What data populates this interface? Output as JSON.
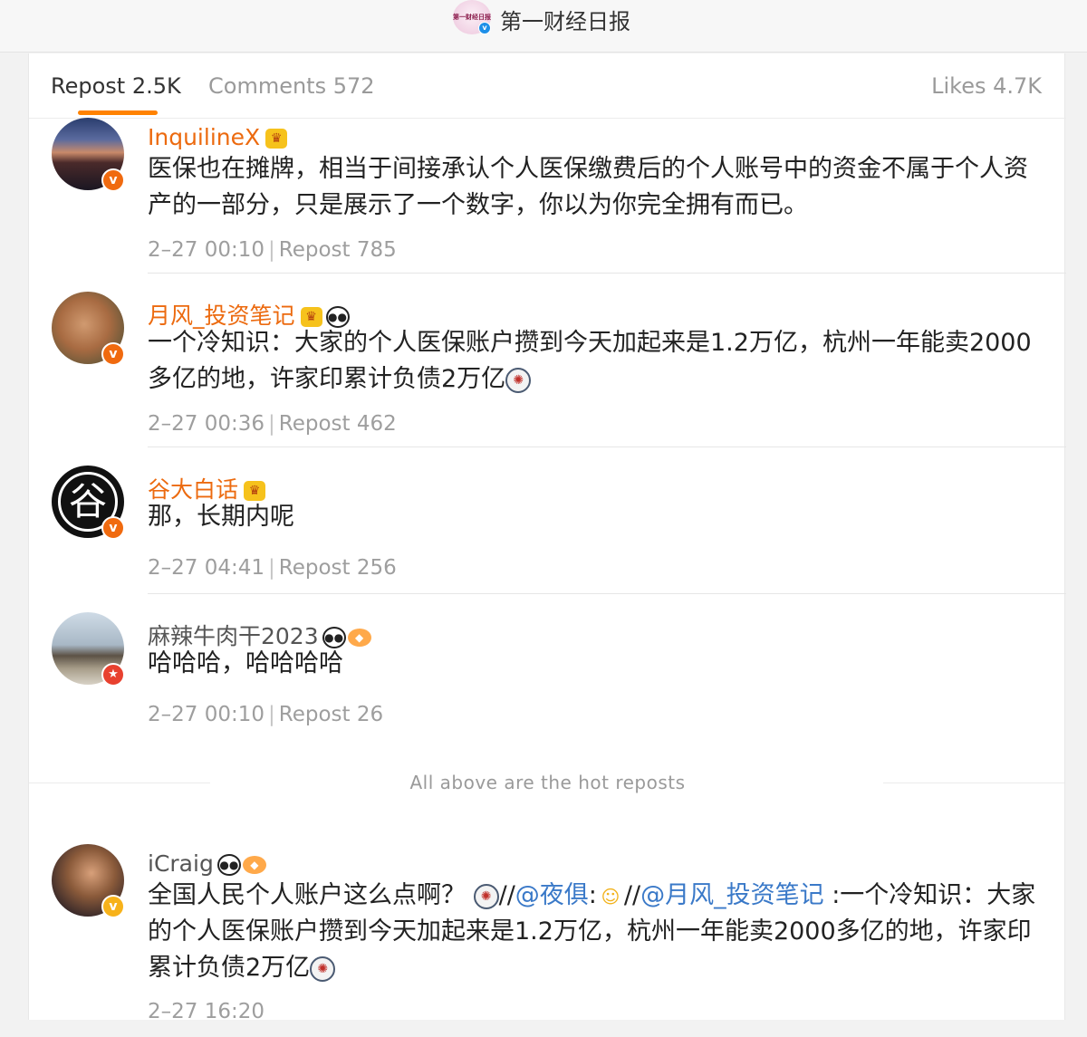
{
  "header": {
    "account_name": "第一财经日报",
    "avatar_mini_text": "第一财经日报",
    "verified_mark": "v"
  },
  "tabs": {
    "repost": "Repost 2.5K",
    "comments": "Comments 572",
    "likes": "Likes 4.7K"
  },
  "hot_reposts": [
    {
      "user": "InquilineX",
      "badge": "v",
      "text": "医保也在摊牌，相当于间接承认个人医保缴费后的个人账号中的资金不属于个人资产的一部分，只是展示了一个数字，你以为你完全拥有而已。",
      "time": "2–27 00:10",
      "reposts": "Repost 785"
    },
    {
      "user": "月风_投资笔记",
      "badge": "v",
      "text": "一个冷知识：大家的个人医保账户攒到今天加起来是1.2万亿，杭州一年能卖2000多亿的地，许家印累计负债2万亿",
      "time": "2–27 00:36",
      "reposts": "Repost 462"
    },
    {
      "user": "谷大白话",
      "badge": "v",
      "avatar_char": "谷",
      "text": "那，长期内呢",
      "time": "2–27 04:41",
      "reposts": "Repost 256"
    },
    {
      "user": "麻辣牛肉干2023",
      "badge": "★",
      "text": "哈哈哈，哈哈哈哈",
      "time": "2–27 00:10",
      "reposts": "Repost 26"
    }
  ],
  "hot_label": "All above are the hot reposts",
  "latest_repost": {
    "user": "iCraig",
    "badge": "v",
    "text_part1": "全国人民个人账户这么点啊？",
    "sep1": "//",
    "mention1": "@夜俱",
    "colon1": ":",
    "sep2": "//",
    "mention2": "@月风_投资笔记",
    "text_part2": " :一个冷知识：大家的个人医保账户攒到今天加起来是1.2万亿，杭州一年能卖2000多亿的地，许家印累计负债2万亿",
    "time": "2–27 16:20"
  },
  "icons": [
    "crown-icon",
    "panda-icon",
    "fish-icon",
    "dizzy-face-icon",
    "shrug-icon",
    "verified-v-icon"
  ],
  "colors": {
    "accent": "#ff8200",
    "username_orange": "#ec6a0f",
    "mention_blue": "#3a79c8",
    "meta_gray": "#9e9e9e"
  }
}
